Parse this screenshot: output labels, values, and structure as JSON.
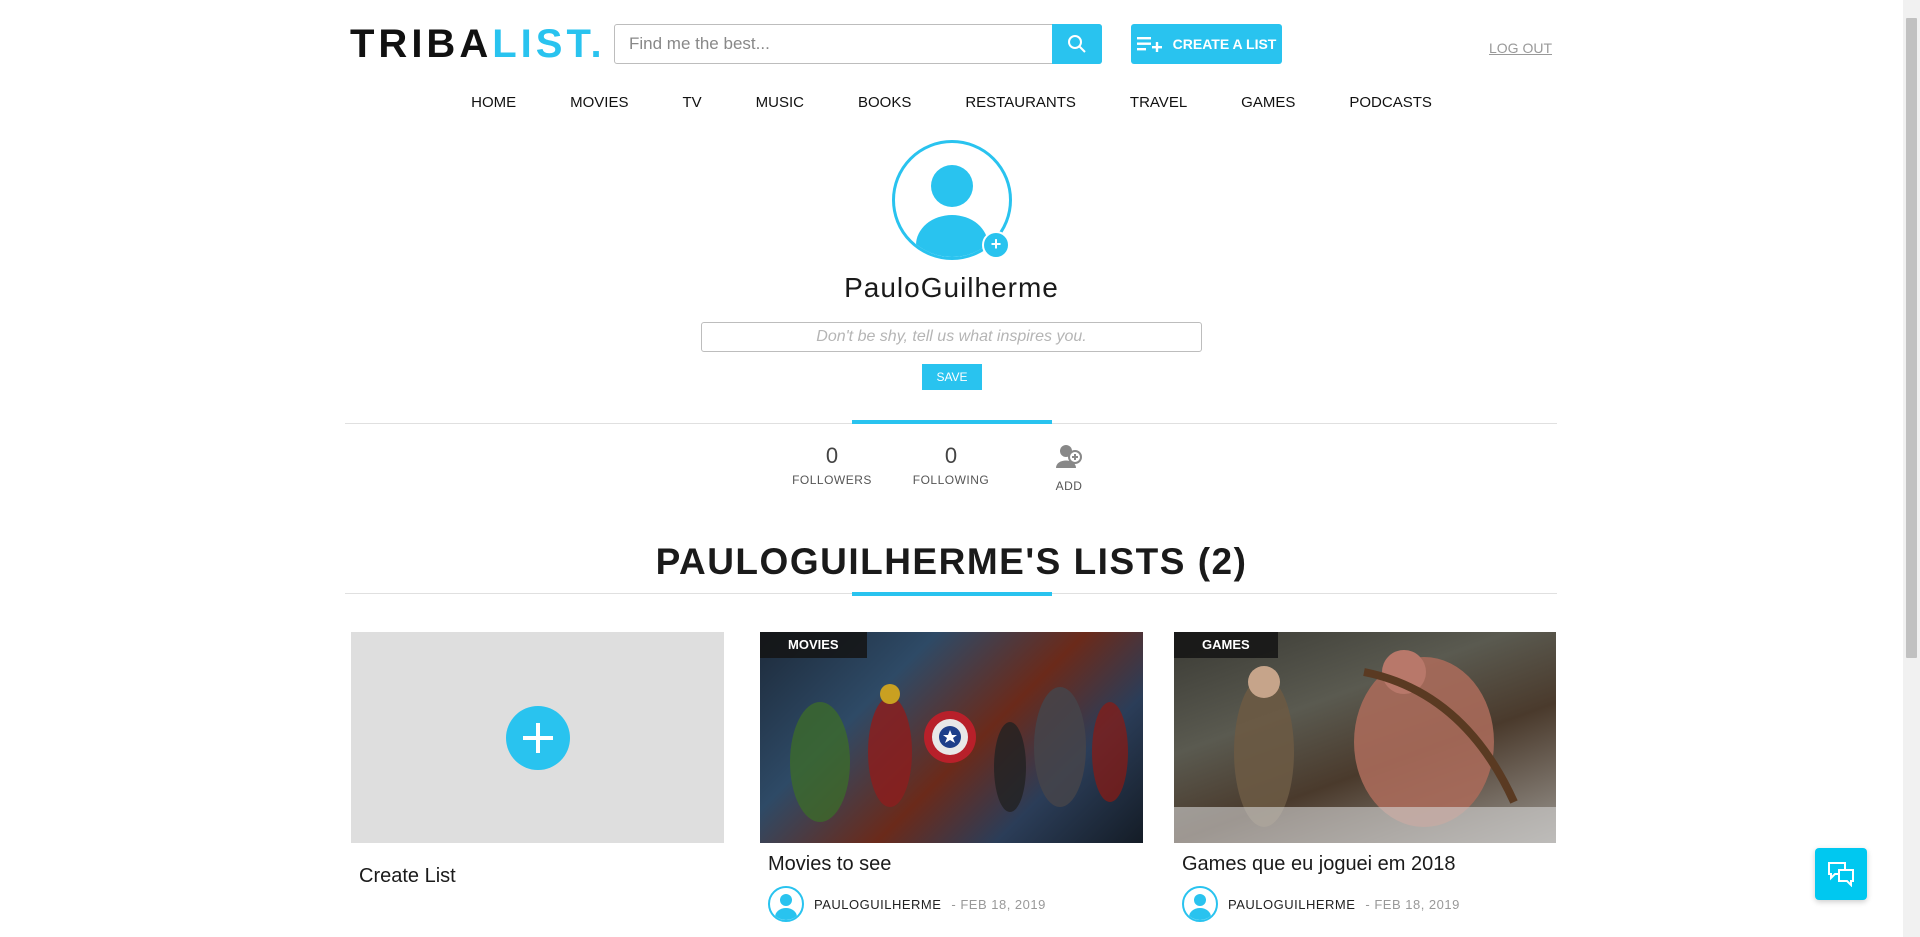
{
  "brand": {
    "part1": "TRIBA",
    "part2": "LIST.",
    "accent_color": "#29c3ef"
  },
  "search": {
    "placeholder": "Find me the best...",
    "value": ""
  },
  "header": {
    "create_label": "CREATE A LIST",
    "logout_label": "LOG OUT"
  },
  "nav": [
    "HOME",
    "MOVIES",
    "TV",
    "MUSIC",
    "BOOKS",
    "RESTAURANTS",
    "TRAVEL",
    "GAMES",
    "PODCASTS"
  ],
  "profile": {
    "username": "PauloGuilherme",
    "bio_placeholder": "Don't be shy, tell us what inspires you.",
    "save_label": "SAVE"
  },
  "stats": {
    "followers": {
      "count": "0",
      "label": "FOLLOWERS"
    },
    "following": {
      "count": "0",
      "label": "FOLLOWING"
    },
    "add": {
      "label": "ADD"
    }
  },
  "lists": {
    "heading": "PAULOGUILHERME'S LISTS (2)",
    "create_label": "Create List",
    "items": [
      {
        "category": "MOVIES",
        "title": "Movies to see",
        "author": "PAULOGUILHERME",
        "date": "- FEB 18, 2019"
      },
      {
        "category": "GAMES",
        "title": "Games que eu joguei em 2018",
        "author": "PAULOGUILHERME",
        "date": "- FEB 18, 2019"
      }
    ]
  },
  "icons": {
    "search": "search-icon",
    "create": "playlist-add-icon",
    "chat": "chat-icon",
    "add_friend": "add-user-icon"
  }
}
